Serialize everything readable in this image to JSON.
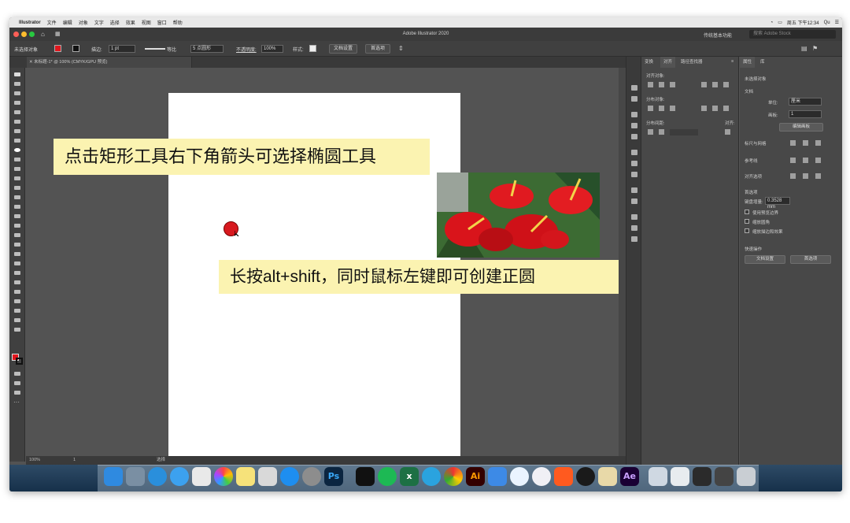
{
  "menubar": {
    "app_name": "Illustrator",
    "items": [
      "文件",
      "编辑",
      "对象",
      "文字",
      "选择",
      "效果",
      "视图",
      "窗口",
      "帮助"
    ],
    "clock": "周五 下午12:34",
    "user": "Qu"
  },
  "window": {
    "title": "Adobe Illustrator 2020",
    "workspace": "传统基本功能",
    "search_placeholder": "搜索 Adobe Stock"
  },
  "control_bar": {
    "selection_label": "未选择对象",
    "stroke_label": "描边:",
    "stroke_value": "1 pt",
    "stroke_profile": "等比",
    "brush": "5 点圆形",
    "opacity_label": "不透明度:",
    "opacity_value": "100%",
    "style_label": "样式:",
    "doc_setup": "文档设置",
    "preferences": "首选项",
    "fill_color": "#e0161d"
  },
  "document": {
    "tab_title": "未标题-1* @ 100% (CMYK/GPU 预览)",
    "zoom": "100%",
    "artboard_number": "1",
    "status_tool": "选择"
  },
  "captions": {
    "top": "点击矩形工具右下角箭头可选择椭圆工具",
    "bottom": "长按alt+shift，同时鼠标左键即可创建正圆"
  },
  "align_panel": {
    "tabs": [
      "变换",
      "对齐",
      "路径查找器"
    ],
    "align_objects": "对齐对象:",
    "distribute_objects": "分布对象:",
    "distribute_spacing": "分布间距:",
    "align_to": "对齐:"
  },
  "properties_panel": {
    "tabs": [
      "属性",
      "库"
    ],
    "no_selection": "未选择对象",
    "document_section": "文档",
    "units_label": "单位:",
    "units_value": "厘米",
    "artboard_label": "画板:",
    "artboard_value": "1",
    "edit_artboard_button": "编辑画板",
    "ruler_grid": "标尺与网格",
    "guides": "参考线",
    "snap": "对齐选项",
    "preferences_section": "首选项",
    "keyboard_increment_label": "键盘增量:",
    "keyboard_increment_value": "0.3528 mm",
    "check_preview_bounds": "使用预览边界",
    "check_scale_corners": "缩放圆角",
    "check_scale_strokes": "缩放描边和效果",
    "quick_actions": "快速操作",
    "doc_setup_button": "文档设置",
    "preferences_button": "首选项"
  },
  "dock": {
    "ps_label": "Ps",
    "ai_label": "Ai",
    "ae_label": "Ae",
    "x_label": "x"
  }
}
